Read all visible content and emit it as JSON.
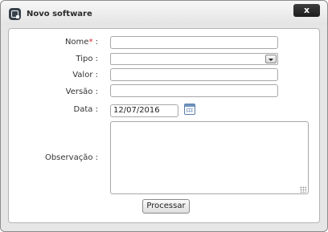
{
  "dialog": {
    "title": "Novo software",
    "close_label": "x"
  },
  "form": {
    "nome_label": "Nome",
    "required_mark": "*",
    "colon": ":",
    "tipo_label": "Tipo",
    "valor_label": "Valor",
    "versao_label": "Versão",
    "data_label": "Data",
    "data_value": "12/07/2016",
    "observacao_label": "Observação",
    "submit_label": "Processar"
  },
  "icons": {
    "app": "app-logo-icon",
    "calendar": "calendar-icon",
    "dropdown": "chevron-down-icon"
  }
}
